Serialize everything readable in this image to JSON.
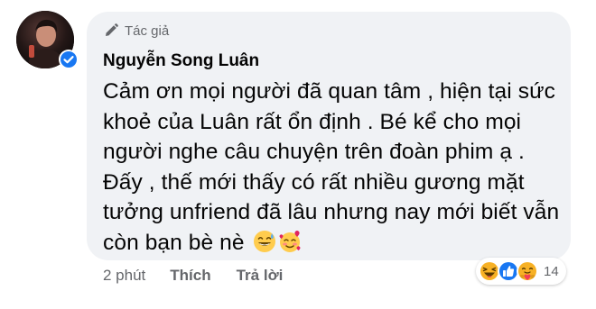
{
  "author_badge": {
    "label": "Tác giả",
    "icon": "pen-icon"
  },
  "author": {
    "name": "Nguyễn Song Luân",
    "verified": true
  },
  "comment": {
    "text": "Cảm ơn mọi người đã quan tâm , hiện tại sức khoẻ của Luân rất ổn định . Bé kể cho mọi người nghe câu chuyện trên đoàn phim ạ . Đấy , thế mới thấy có rất nhiều gương mặt tưởng unfriend đã lâu nhưng nay mới biết vẫn còn bạn bè nè",
    "emojis": [
      "grinning-sweat-emoji",
      "smiling-hearts-emoji"
    ]
  },
  "actions": {
    "time": "2 phút",
    "like": "Thích",
    "reply": "Trả lời"
  },
  "reactions": {
    "types": [
      "haha-icon",
      "like-icon",
      "care-icon"
    ],
    "count": "14"
  },
  "colors": {
    "bubble_bg": "#f0f2f5",
    "secondary_text": "#65676b",
    "primary_text": "#050505",
    "verified_blue": "#1877f2"
  }
}
